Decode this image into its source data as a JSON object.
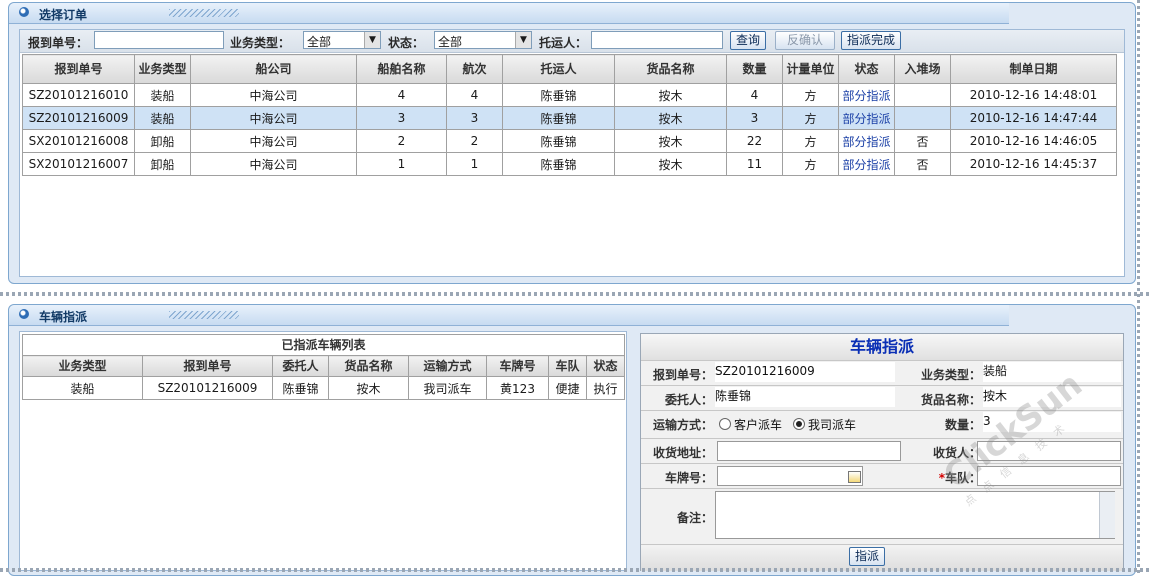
{
  "order_panel": {
    "title": "选择订单",
    "filters": {
      "report_no_label": "报到单号：",
      "report_no_value": "",
      "biz_type_label": "业务类型：",
      "biz_type_value": "全部",
      "status_label": "状态：",
      "status_value": "全部",
      "shipper_label": "托运人：",
      "shipper_value": "",
      "query_button": "查询",
      "unconfirm_button": "反确认",
      "dispatch_done_button": "指派完成"
    },
    "columns": [
      "报到单号",
      "业务类型",
      "船公司",
      "船舶名称",
      "航次",
      "托运人",
      "货品名称",
      "数量",
      "计量单位",
      "状态",
      "入堆场",
      "制单日期"
    ],
    "rows": [
      [
        "SZ20101216010",
        "装船",
        "中海公司",
        "4",
        "4",
        "陈垂锦",
        "按木",
        "4",
        "方",
        "部分指派",
        "",
        "2010-12-16 14:48:01"
      ],
      [
        "SZ20101216009",
        "装船",
        "中海公司",
        "3",
        "3",
        "陈垂锦",
        "按木",
        "3",
        "方",
        "部分指派",
        "",
        "2010-12-16 14:47:44"
      ],
      [
        "SX20101216008",
        "卸船",
        "中海公司",
        "2",
        "2",
        "陈垂锦",
        "按木",
        "22",
        "方",
        "部分指派",
        "否",
        "2010-12-16 14:46:05"
      ],
      [
        "SX20101216007",
        "卸船",
        "中海公司",
        "1",
        "1",
        "陈垂锦",
        "按木",
        "11",
        "方",
        "部分指派",
        "否",
        "2010-12-16 14:45:37"
      ]
    ],
    "selected_row": 1
  },
  "vehicle_panel": {
    "title": "车辆指派",
    "list_title": "已指派车辆列表",
    "columns": [
      "业务类型",
      "报到单号",
      "委托人",
      "货品名称",
      "运输方式",
      "车牌号",
      "车队",
      "状态"
    ],
    "rows": [
      [
        "装船",
        "SZ20101216009",
        "陈垂锦",
        "按木",
        "我司派车",
        "黄123",
        "便捷",
        "执行"
      ]
    ],
    "form": {
      "title": "车辆指派",
      "report_no_label": "报到单号：",
      "report_no_value": "SZ20101216009",
      "biz_type_label": "业务类型：",
      "biz_type_value": "装船",
      "client_label": "委托人：",
      "client_value": "陈垂锦",
      "goods_label": "货品名称：",
      "goods_value": "按木",
      "transport_label": "运输方式：",
      "transport_option_customer": "客户派车",
      "transport_option_ours": "我司派车",
      "transport_selected": "我司派车",
      "quantity_label": "数量：",
      "quantity_value": "3",
      "address_label": "收货地址：",
      "address_value": "",
      "consignee_label": "收货人：",
      "consignee_value": "",
      "plate_label": "车牌号：",
      "plate_value": "",
      "fleet_label": "车队：",
      "fleet_value": "",
      "required_mark": "*",
      "remark_label": "备注：",
      "remark_value": "",
      "dispatch_button": "指派"
    }
  },
  "watermark": {
    "text": "ClickSun",
    "sub": "点 点 信 息 技 术"
  },
  "colors": {
    "link": "#1a3fa6",
    "title_blue": "#0a2fb5",
    "selected_row": "#cfe2f5",
    "required": "#d40000"
  }
}
